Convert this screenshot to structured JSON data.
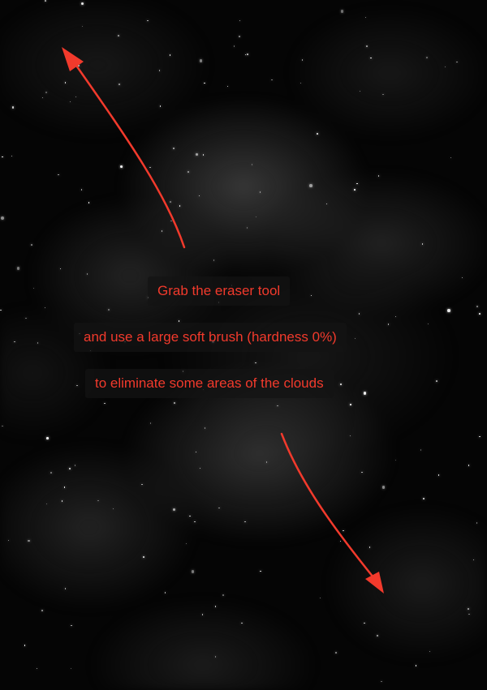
{
  "instructions": {
    "line_1": "Grab the eraser tool",
    "line_2": "and use a large soft brush (hardness 0%)",
    "line_3": "to eliminate some areas of the clouds"
  },
  "colors": {
    "annotation_red": "#f23a2c",
    "background": "#050505"
  },
  "icons": {
    "arrow_up_left": "arrow-up-left-icon",
    "arrow_down_right": "arrow-down-right-icon"
  }
}
